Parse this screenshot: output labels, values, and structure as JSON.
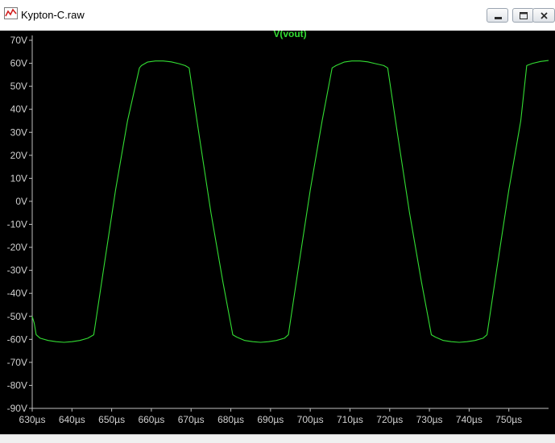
{
  "window": {
    "title": "Kypton-C.raw",
    "controls": [
      "minimize",
      "maximize",
      "close"
    ]
  },
  "icons": {
    "app": "waveform-icon",
    "minimize": "minimize-icon",
    "maximize": "maximize-icon",
    "close": "close-icon"
  },
  "colors": {
    "background": "#000000",
    "trace": "#33dd33",
    "axis": "#c0c0c0",
    "tick_text": "#cfcfcf"
  },
  "chart_data": {
    "type": "line",
    "title": "V(vout)",
    "xlabel": "",
    "ylabel": "",
    "xlim": [
      630,
      760
    ],
    "ylim": [
      -90,
      70
    ],
    "x_unit": "µs",
    "y_unit": "V",
    "grid": false,
    "y_ticks": [
      70,
      60,
      50,
      40,
      30,
      20,
      10,
      0,
      -10,
      -20,
      -30,
      -40,
      -50,
      -60,
      -70,
      -80,
      -90
    ],
    "y_tick_labels": [
      "70V",
      "60V",
      "50V",
      "40V",
      "30V",
      "20V",
      "10V",
      "0V",
      "-10V",
      "-20V",
      "-30V",
      "-40V",
      "-50V",
      "-60V",
      "-70V",
      "-80V",
      "-90V"
    ],
    "x_ticks": [
      630,
      640,
      650,
      660,
      670,
      680,
      690,
      700,
      710,
      720,
      730,
      740,
      750
    ],
    "x_tick_labels": [
      "630µs",
      "640µs",
      "650µs",
      "660µs",
      "670µs",
      "680µs",
      "690µs",
      "700µs",
      "710µs",
      "720µs",
      "730µs",
      "740µs",
      "750µs"
    ],
    "series": [
      {
        "name": "V(vout)",
        "x": [
          630.0,
          630.5,
          631.0,
          632.0,
          634.0,
          636.0,
          638.0,
          640.0,
          642.0,
          644.0,
          645.5,
          648.0,
          651.0,
          654.0,
          657.0,
          657.5,
          659.0,
          661.0,
          663.0,
          665.0,
          667.0,
          668.5,
          669.5,
          672.0,
          675.0,
          678.0,
          680.5,
          681.5,
          683.5,
          685.5,
          687.5,
          689.5,
          691.5,
          693.5,
          694.5,
          697.0,
          700.0,
          703.0,
          705.5,
          706.5,
          708.5,
          710.5,
          712.5,
          714.5,
          716.5,
          718.5,
          719.5,
          722.0,
          725.0,
          728.0,
          730.5,
          731.5,
          733.5,
          735.5,
          737.5,
          739.5,
          741.5,
          743.5,
          744.5,
          747.0,
          750.0,
          753.0,
          754.5,
          756.0,
          758.0,
          760.0
        ],
        "values": [
          -50,
          -53,
          -58,
          -59.5,
          -60.5,
          -61,
          -61.3,
          -61,
          -60.5,
          -59.5,
          -58,
          -29,
          5,
          35,
          58,
          59,
          60.5,
          61,
          61,
          60.6,
          59.8,
          59,
          58,
          29,
          -5,
          -35,
          -58,
          -59,
          -60.5,
          -61,
          -61.3,
          -61,
          -60.5,
          -59.5,
          -58,
          -29,
          5,
          35,
          58,
          59,
          60.5,
          61,
          61,
          60.6,
          59.8,
          59,
          58,
          29,
          -5,
          -35,
          -58,
          -59,
          -60.5,
          -61,
          -61.3,
          -61,
          -60.5,
          -59.5,
          -58,
          -29,
          5,
          35,
          59,
          60,
          60.8,
          61.2
        ]
      }
    ]
  }
}
